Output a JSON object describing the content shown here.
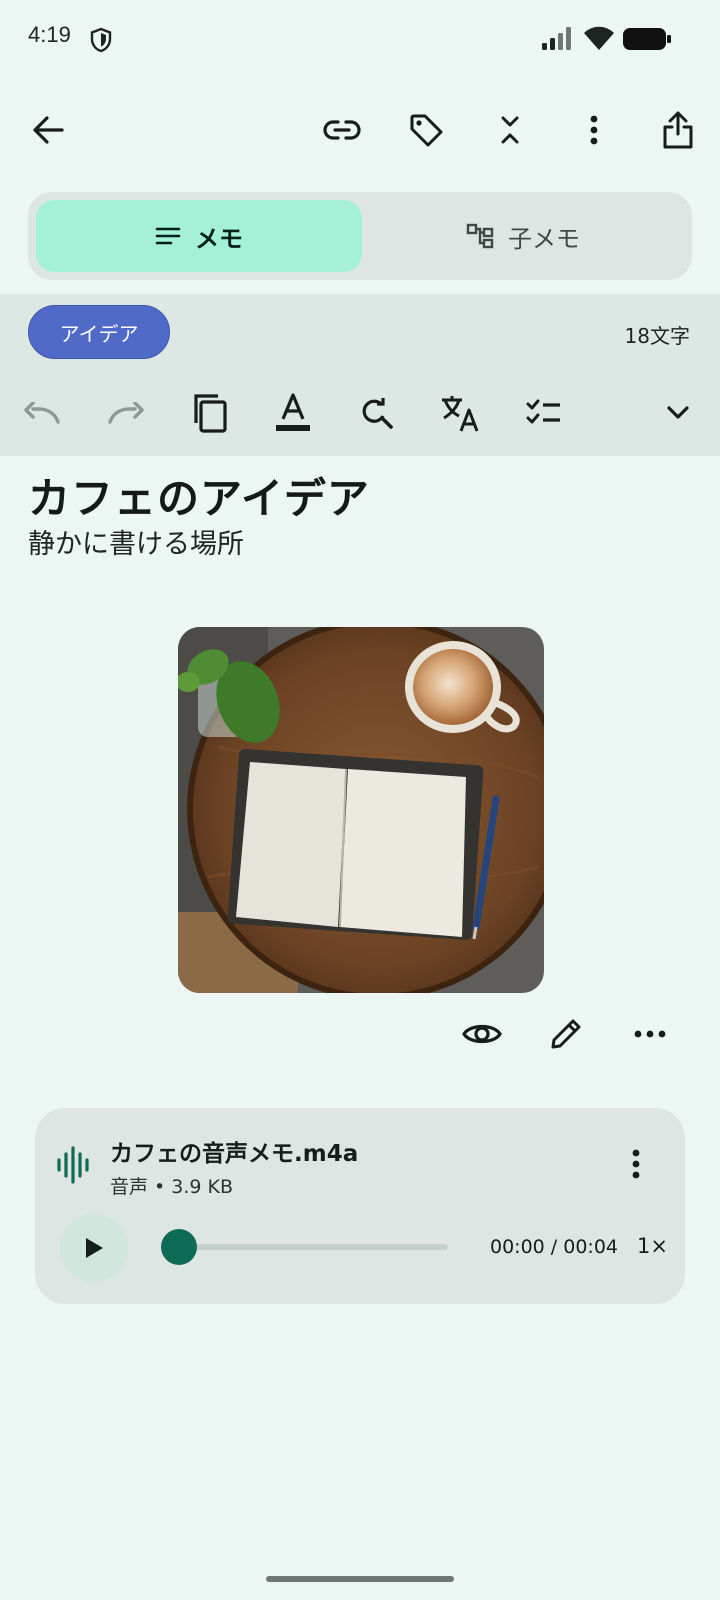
{
  "status": {
    "time": "4:19"
  },
  "toolbar": {
    "icons": [
      "back-icon",
      "link-icon",
      "tag-icon",
      "collapse-icon",
      "more-vert-icon",
      "share-icon"
    ]
  },
  "tabs": [
    {
      "label": "メモ",
      "icon": "notes-icon",
      "selected": true
    },
    {
      "label": "子メモ",
      "icon": "tree-icon",
      "selected": false
    }
  ],
  "tag": {
    "label": "アイデア"
  },
  "char_count": "18文字",
  "format_icons": [
    "undo-icon",
    "redo-icon",
    "copy-icon",
    "text-color-icon",
    "find-replace-icon",
    "translate-icon",
    "checklist-icon",
    "expand-icon"
  ],
  "note": {
    "title": "カフェのアイデア",
    "body": "静かに書ける場所"
  },
  "image_actions": [
    "view-icon",
    "edit-icon",
    "more-horiz-icon"
  ],
  "audio": {
    "filename": "カフェの音声メモ.m4a",
    "meta": "音声 • 3.9 KB",
    "time": "00:00 / 00:04",
    "speed": "1×",
    "progress": 0.0
  },
  "colors": {
    "background": "#ecf6f3",
    "accent": "#0e6b55",
    "tab_selected": "#a5f1d8",
    "tag": "#4f6bc7"
  }
}
